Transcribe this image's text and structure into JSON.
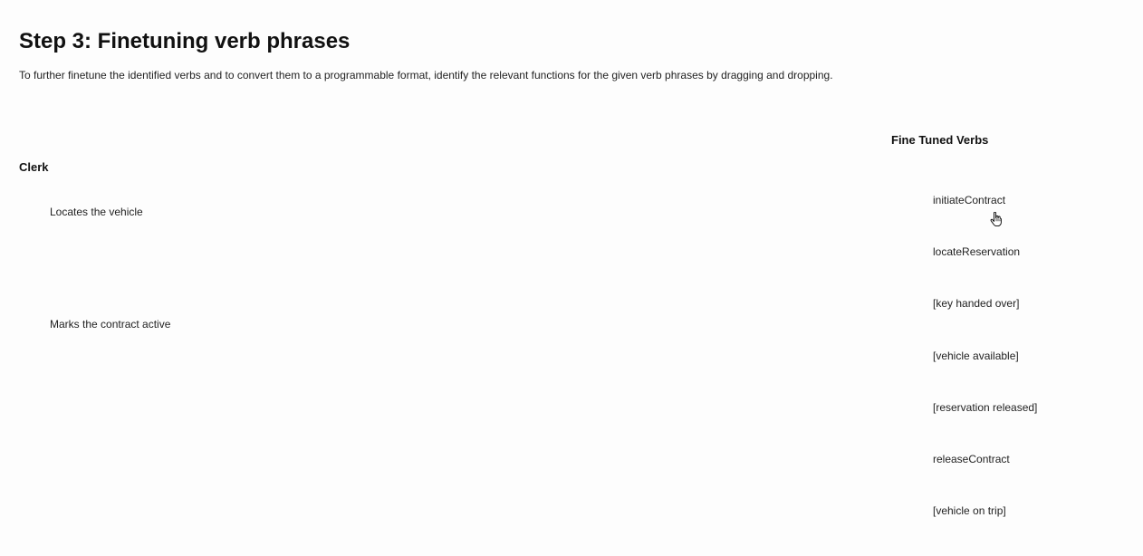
{
  "page": {
    "title": "Step 3: Finetuning verb phrases",
    "instructions": "To further finetune the identified verbs and to convert them to a programmable format, identify the relevant functions for the given verb phrases by dragging and dropping."
  },
  "actor": {
    "name": "Clerk",
    "phrases": [
      "Locates the vehicle",
      "Marks the contract active"
    ]
  },
  "verbs_panel": {
    "title": "Fine Tuned Verbs",
    "items": [
      "initiateContract",
      "locateReservation",
      "[key handed over]",
      "[vehicle available]",
      "[reservation released]",
      "releaseContract",
      "[vehicle on trip]"
    ]
  },
  "icons": {
    "cursor": "hand-pointer-icon"
  }
}
